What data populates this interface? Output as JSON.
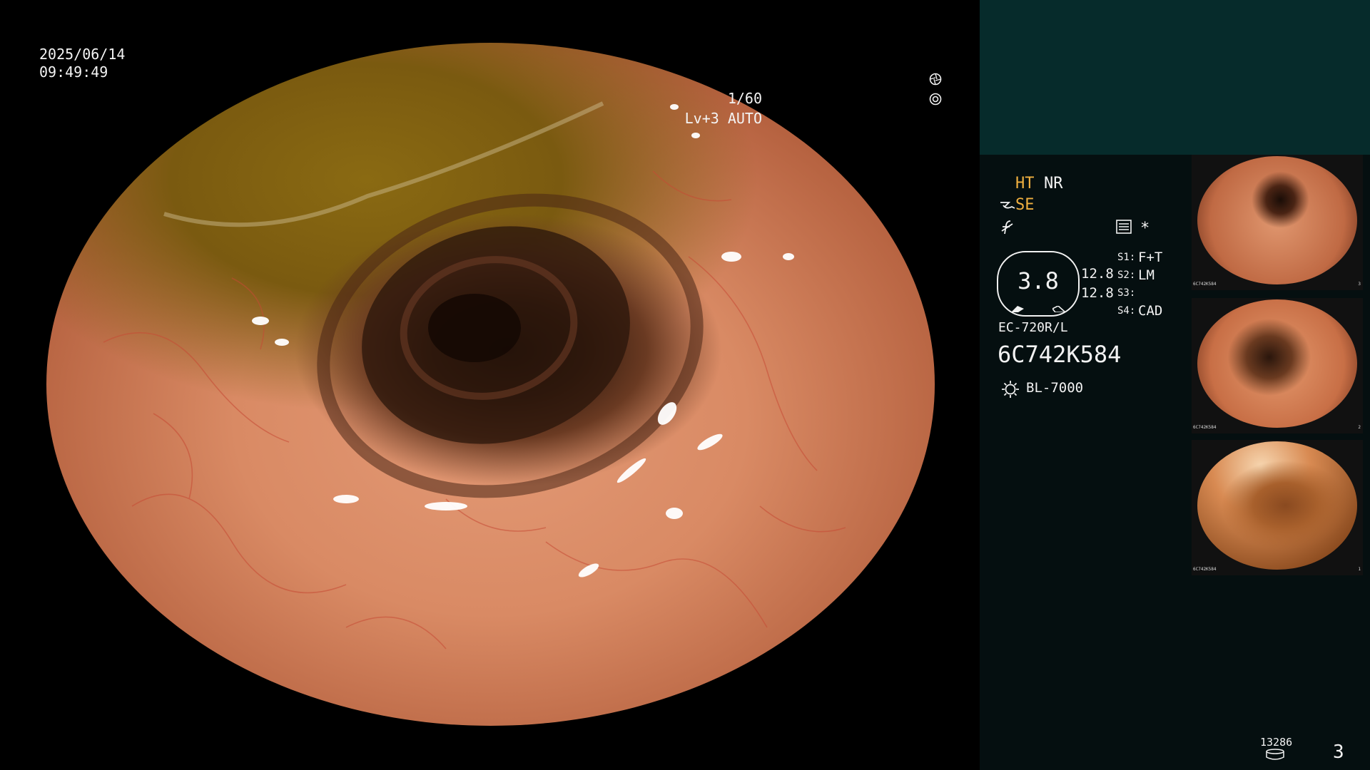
{
  "overlay": {
    "date": "2025/06/14",
    "time": "09:49:49",
    "shutter": "1/60",
    "shutter_icon": "aperture-icon",
    "level": "Lv+3 AUTO",
    "level_icon": "auto-exposure-icon"
  },
  "panel": {
    "ht": "HT",
    "nr": "NR",
    "se": "SE",
    "se_icon": "structure-enhance-icon",
    "f_icon": "f-symbol-icon",
    "menu_icon": "settings-list-icon",
    "star": "*",
    "gauge_value": "3.8",
    "side_values": [
      "12.8",
      "12.8"
    ],
    "switches": [
      {
        "label": "S1",
        "value": "F+T"
      },
      {
        "label": "S2",
        "value": "LM"
      },
      {
        "label": "S3",
        "value": ""
      },
      {
        "label": "S4",
        "value": "CAD"
      }
    ],
    "model": "EC-720R/L",
    "serial": "6C742K584",
    "light_source": "BL-7000",
    "light_icon": "light-source-icon"
  },
  "thumbnails": [
    {
      "serial": "6C742K584",
      "index": "3"
    },
    {
      "serial": "6C742K584",
      "index": "2"
    },
    {
      "serial": "6C742K584",
      "index": "1"
    }
  ],
  "footer": {
    "counter": "13286",
    "db_icon": "storage-icon",
    "page": "3"
  },
  "colors": {
    "accent": "#f0b040",
    "panel_top": "#062b2b",
    "panel_main": "#050f10"
  }
}
